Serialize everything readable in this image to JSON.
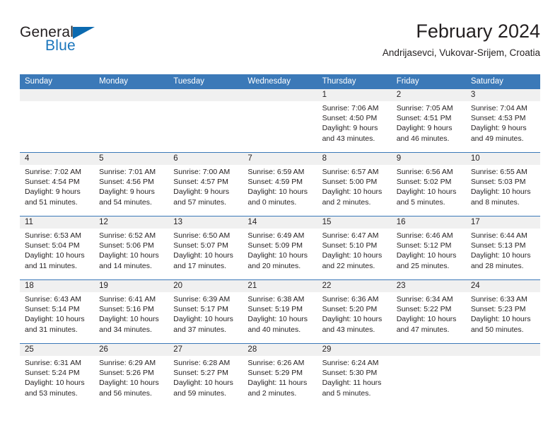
{
  "brand": {
    "name_top": "General",
    "name_bottom": "Blue",
    "accent_color": "#0b6ab0"
  },
  "header": {
    "title": "February 2024",
    "subtitle": "Andrijasevci, Vukovar-Srijem, Croatia"
  },
  "calendar": {
    "header_color": "#3b79b8",
    "daynum_band_color": "#f0f0f0",
    "weekdays": [
      "Sunday",
      "Monday",
      "Tuesday",
      "Wednesday",
      "Thursday",
      "Friday",
      "Saturday"
    ],
    "weeks": [
      [
        {
          "day": "",
          "lines": []
        },
        {
          "day": "",
          "lines": []
        },
        {
          "day": "",
          "lines": []
        },
        {
          "day": "",
          "lines": []
        },
        {
          "day": "1",
          "lines": [
            "Sunrise: 7:06 AM",
            "Sunset: 4:50 PM",
            "Daylight: 9 hours",
            "and 43 minutes."
          ]
        },
        {
          "day": "2",
          "lines": [
            "Sunrise: 7:05 AM",
            "Sunset: 4:51 PM",
            "Daylight: 9 hours",
            "and 46 minutes."
          ]
        },
        {
          "day": "3",
          "lines": [
            "Sunrise: 7:04 AM",
            "Sunset: 4:53 PM",
            "Daylight: 9 hours",
            "and 49 minutes."
          ]
        }
      ],
      [
        {
          "day": "4",
          "lines": [
            "Sunrise: 7:02 AM",
            "Sunset: 4:54 PM",
            "Daylight: 9 hours",
            "and 51 minutes."
          ]
        },
        {
          "day": "5",
          "lines": [
            "Sunrise: 7:01 AM",
            "Sunset: 4:56 PM",
            "Daylight: 9 hours",
            "and 54 minutes."
          ]
        },
        {
          "day": "6",
          "lines": [
            "Sunrise: 7:00 AM",
            "Sunset: 4:57 PM",
            "Daylight: 9 hours",
            "and 57 minutes."
          ]
        },
        {
          "day": "7",
          "lines": [
            "Sunrise: 6:59 AM",
            "Sunset: 4:59 PM",
            "Daylight: 10 hours",
            "and 0 minutes."
          ]
        },
        {
          "day": "8",
          "lines": [
            "Sunrise: 6:57 AM",
            "Sunset: 5:00 PM",
            "Daylight: 10 hours",
            "and 2 minutes."
          ]
        },
        {
          "day": "9",
          "lines": [
            "Sunrise: 6:56 AM",
            "Sunset: 5:02 PM",
            "Daylight: 10 hours",
            "and 5 minutes."
          ]
        },
        {
          "day": "10",
          "lines": [
            "Sunrise: 6:55 AM",
            "Sunset: 5:03 PM",
            "Daylight: 10 hours",
            "and 8 minutes."
          ]
        }
      ],
      [
        {
          "day": "11",
          "lines": [
            "Sunrise: 6:53 AM",
            "Sunset: 5:04 PM",
            "Daylight: 10 hours",
            "and 11 minutes."
          ]
        },
        {
          "day": "12",
          "lines": [
            "Sunrise: 6:52 AM",
            "Sunset: 5:06 PM",
            "Daylight: 10 hours",
            "and 14 minutes."
          ]
        },
        {
          "day": "13",
          "lines": [
            "Sunrise: 6:50 AM",
            "Sunset: 5:07 PM",
            "Daylight: 10 hours",
            "and 17 minutes."
          ]
        },
        {
          "day": "14",
          "lines": [
            "Sunrise: 6:49 AM",
            "Sunset: 5:09 PM",
            "Daylight: 10 hours",
            "and 20 minutes."
          ]
        },
        {
          "day": "15",
          "lines": [
            "Sunrise: 6:47 AM",
            "Sunset: 5:10 PM",
            "Daylight: 10 hours",
            "and 22 minutes."
          ]
        },
        {
          "day": "16",
          "lines": [
            "Sunrise: 6:46 AM",
            "Sunset: 5:12 PM",
            "Daylight: 10 hours",
            "and 25 minutes."
          ]
        },
        {
          "day": "17",
          "lines": [
            "Sunrise: 6:44 AM",
            "Sunset: 5:13 PM",
            "Daylight: 10 hours",
            "and 28 minutes."
          ]
        }
      ],
      [
        {
          "day": "18",
          "lines": [
            "Sunrise: 6:43 AM",
            "Sunset: 5:14 PM",
            "Daylight: 10 hours",
            "and 31 minutes."
          ]
        },
        {
          "day": "19",
          "lines": [
            "Sunrise: 6:41 AM",
            "Sunset: 5:16 PM",
            "Daylight: 10 hours",
            "and 34 minutes."
          ]
        },
        {
          "day": "20",
          "lines": [
            "Sunrise: 6:39 AM",
            "Sunset: 5:17 PM",
            "Daylight: 10 hours",
            "and 37 minutes."
          ]
        },
        {
          "day": "21",
          "lines": [
            "Sunrise: 6:38 AM",
            "Sunset: 5:19 PM",
            "Daylight: 10 hours",
            "and 40 minutes."
          ]
        },
        {
          "day": "22",
          "lines": [
            "Sunrise: 6:36 AM",
            "Sunset: 5:20 PM",
            "Daylight: 10 hours",
            "and 43 minutes."
          ]
        },
        {
          "day": "23",
          "lines": [
            "Sunrise: 6:34 AM",
            "Sunset: 5:22 PM",
            "Daylight: 10 hours",
            "and 47 minutes."
          ]
        },
        {
          "day": "24",
          "lines": [
            "Sunrise: 6:33 AM",
            "Sunset: 5:23 PM",
            "Daylight: 10 hours",
            "and 50 minutes."
          ]
        }
      ],
      [
        {
          "day": "25",
          "lines": [
            "Sunrise: 6:31 AM",
            "Sunset: 5:24 PM",
            "Daylight: 10 hours",
            "and 53 minutes."
          ]
        },
        {
          "day": "26",
          "lines": [
            "Sunrise: 6:29 AM",
            "Sunset: 5:26 PM",
            "Daylight: 10 hours",
            "and 56 minutes."
          ]
        },
        {
          "day": "27",
          "lines": [
            "Sunrise: 6:28 AM",
            "Sunset: 5:27 PM",
            "Daylight: 10 hours",
            "and 59 minutes."
          ]
        },
        {
          "day": "28",
          "lines": [
            "Sunrise: 6:26 AM",
            "Sunset: 5:29 PM",
            "Daylight: 11 hours",
            "and 2 minutes."
          ]
        },
        {
          "day": "29",
          "lines": [
            "Sunrise: 6:24 AM",
            "Sunset: 5:30 PM",
            "Daylight: 11 hours",
            "and 5 minutes."
          ]
        },
        {
          "day": "",
          "lines": []
        },
        {
          "day": "",
          "lines": []
        }
      ]
    ]
  }
}
